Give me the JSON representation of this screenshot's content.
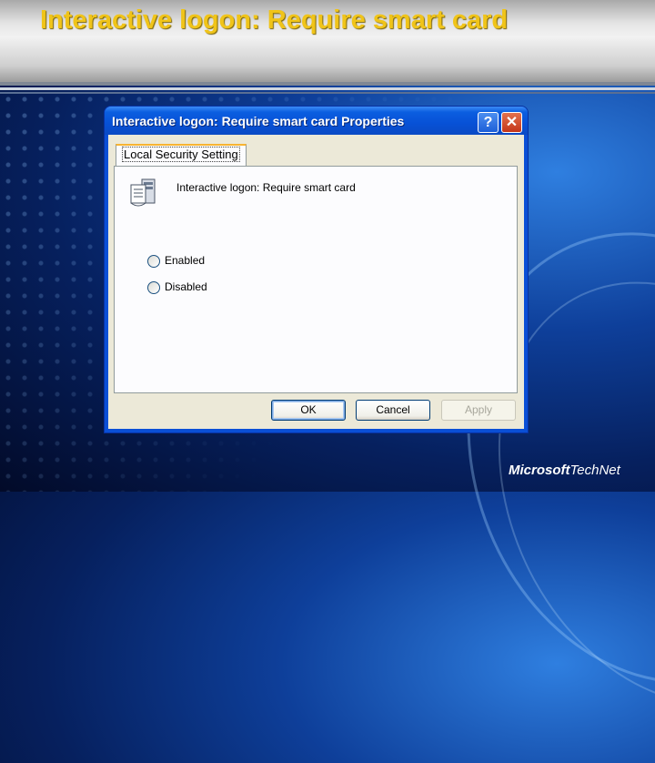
{
  "slide": {
    "title": "Interactive logon: Require smart card",
    "logo_text_1": "Microsoft",
    "logo_text_2": "TechNet"
  },
  "dialog": {
    "title": "Interactive logon: Require smart card Properties",
    "help_label": "?",
    "close_label": "✕",
    "tabs": [
      {
        "label": "Local Security Setting"
      }
    ],
    "policy_icon": "server-policy-icon",
    "policy_name": "Interactive logon: Require smart card",
    "options": [
      {
        "label": "Enabled",
        "checked": false
      },
      {
        "label": "Disabled",
        "checked": false
      }
    ],
    "buttons": {
      "ok": "OK",
      "cancel": "Cancel",
      "apply": "Apply"
    }
  },
  "colors": {
    "title_yellow": "#f0c419",
    "xp_blue": "#0a4fd6",
    "dialog_face": "#ece9d8"
  }
}
